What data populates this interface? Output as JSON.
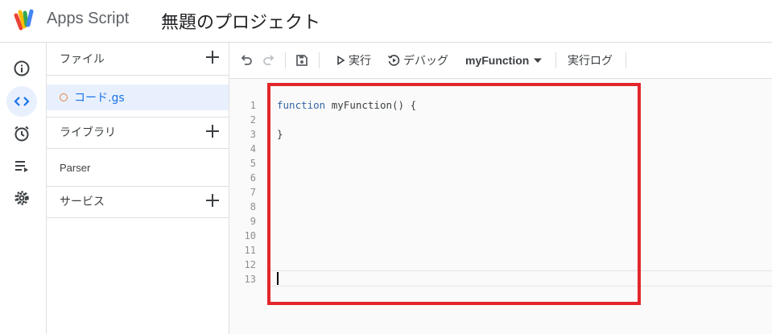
{
  "header": {
    "app_name": "Apps Script",
    "project_name": "無題のプロジェクト"
  },
  "rail": [
    {
      "name": "info-icon"
    },
    {
      "name": "code-icon",
      "active": true
    },
    {
      "name": "alarm-clock-icon"
    },
    {
      "name": "executions-icon"
    },
    {
      "name": "gear-icon"
    }
  ],
  "files_panel": {
    "files_label": "ファイル",
    "file_name": "コード.gs",
    "libraries_label": "ライブラリ",
    "library_item": "Parser",
    "services_label": "サービス"
  },
  "toolbar": {
    "run_label": "実行",
    "debug_label": "デバッグ",
    "function_name": "myFunction",
    "log_label": "実行ログ"
  },
  "editor": {
    "line_numbers": [
      "1",
      "2",
      "3",
      "4",
      "5",
      "6",
      "7",
      "8",
      "9",
      "10",
      "11",
      "12",
      "13"
    ],
    "code": {
      "line1_keyword": "function",
      "line1_rest": " myFunction() {",
      "line3": "}"
    }
  },
  "colors": {
    "accent": "#1a73e8",
    "highlight_border": "#e3262b",
    "active_bg": "#e8f0fe",
    "file_dot": "#e8833a"
  }
}
